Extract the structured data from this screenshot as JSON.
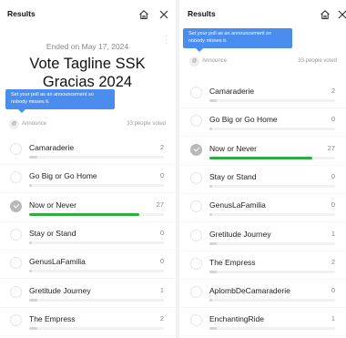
{
  "left": {
    "header_title": "Results",
    "ended": "Ended on May 17, 2024",
    "poll_title_line1": "Vote Tagline SSK",
    "poll_title_line2": "Gracias 2024",
    "tooltip_line1": "Set your poll as an announcement so",
    "tooltip_line2": "nobody misses it.",
    "announce_icon": "@",
    "announce_label": "Announce",
    "people_voted": "33 people voted",
    "options": [
      {
        "label": "Camaraderie",
        "count": "2",
        "votes": 2,
        "checked": false,
        "leader": false
      },
      {
        "label": "Go Big or Go Home",
        "count": "0",
        "votes": 0,
        "checked": false,
        "leader": false
      },
      {
        "label": "Now or Never",
        "count": "27",
        "votes": 27,
        "checked": true,
        "leader": true
      },
      {
        "label": "Stay or Stand",
        "count": "0",
        "votes": 0,
        "checked": false,
        "leader": false
      },
      {
        "label": "GenusLaFamilia",
        "count": "0",
        "votes": 0,
        "checked": false,
        "leader": false
      },
      {
        "label": "Gretitude Journey",
        "count": "1",
        "votes": 1,
        "checked": false,
        "leader": false
      },
      {
        "label": "The Empress",
        "count": "2",
        "votes": 2,
        "checked": false,
        "leader": false
      }
    ]
  },
  "right": {
    "header_title": "Results",
    "tooltip_line1": "Set your poll as an announcement so",
    "tooltip_line2": "nobody misses it.",
    "announce_icon": "@",
    "announce_label": "Announce",
    "people_voted": "33 people voted",
    "options": [
      {
        "label": "Camaraderie",
        "count": "2",
        "votes": 2,
        "checked": false,
        "leader": false
      },
      {
        "label": "Go Big or Go Home",
        "count": "0",
        "votes": 0,
        "checked": false,
        "leader": false
      },
      {
        "label": "Now or Never",
        "count": "27",
        "votes": 27,
        "checked": true,
        "leader": true
      },
      {
        "label": "Stay or Stand",
        "count": "0",
        "votes": 0,
        "checked": false,
        "leader": false
      },
      {
        "label": "GenusLaFamilia",
        "count": "0",
        "votes": 0,
        "checked": false,
        "leader": false
      },
      {
        "label": "Gretitude Journey",
        "count": "1",
        "votes": 1,
        "checked": false,
        "leader": false
      },
      {
        "label": "The Empress",
        "count": "2",
        "votes": 2,
        "checked": false,
        "leader": false
      },
      {
        "label": "AplombDeCamaraderie",
        "count": "0",
        "votes": 0,
        "checked": false,
        "leader": false
      },
      {
        "label": "EnchantingRide",
        "count": "1",
        "votes": 1,
        "checked": false,
        "leader": false
      }
    ]
  },
  "total_votes": 33,
  "icons": {
    "home": "home-icon",
    "close": "close-icon",
    "more": "more-vertical-icon",
    "check": "check-icon"
  },
  "colors": {
    "leader_bar": "#2eae3f",
    "bar": "#d4d4d4",
    "tooltip": "#4a8dee"
  }
}
